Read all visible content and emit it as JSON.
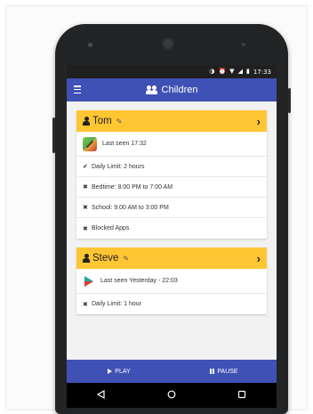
{
  "status_bar": {
    "icons": [
      "sync-icon",
      "alarm-icon",
      "wifi-icon",
      "signal-icon",
      "battery-icon"
    ],
    "time": "17:33"
  },
  "app_bar": {
    "menu_icon": "hamburger-icon",
    "title_icon": "users-icon",
    "title": "Children"
  },
  "children": [
    {
      "name": "Tom",
      "last_seen": "Last seen 17:32",
      "rules": [
        {
          "mark": "✔",
          "text": "Daily Limit: 2 hours"
        },
        {
          "mark": "✖",
          "text": "Bedtime: 8:00 PM to 7:00 AM"
        },
        {
          "mark": "✖",
          "text": "School: 9:00 AM to 3:00 PM"
        },
        {
          "mark": "✖",
          "text": "Blocked Apps"
        }
      ]
    },
    {
      "name": "Steve",
      "last_seen": "Last seen Yesterday - 22:03",
      "rules": [
        {
          "mark": "✖",
          "text": "Daily Limit: 1 hour"
        }
      ]
    }
  ],
  "bottom_bar": {
    "play_label": "PLAY",
    "pause_label": "PAUSE"
  },
  "colors": {
    "primary": "#3f51b5",
    "card_header": "#ffc633"
  }
}
